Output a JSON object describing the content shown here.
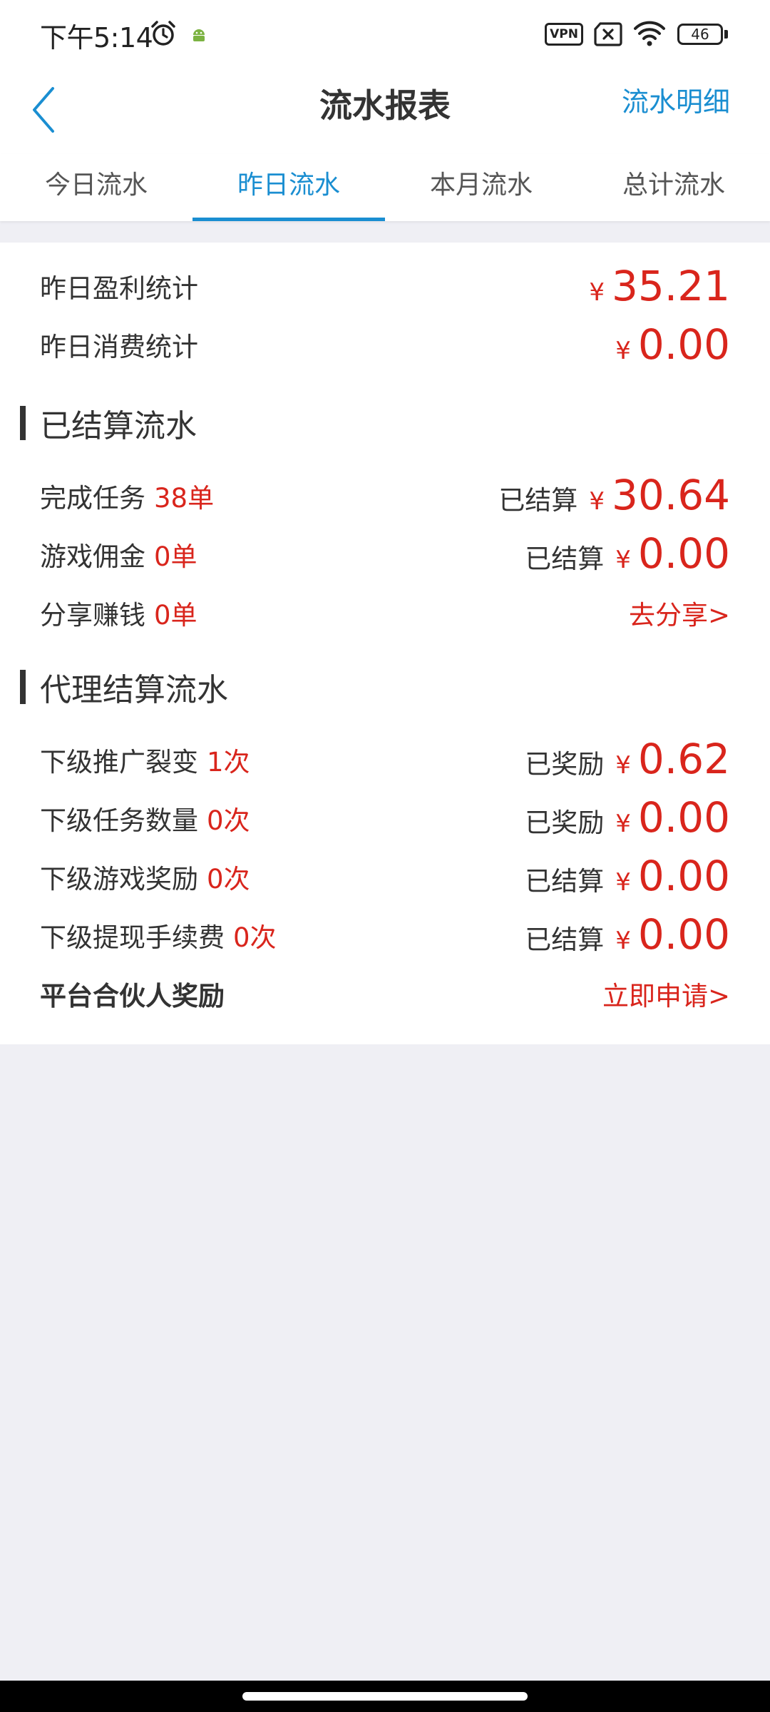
{
  "status_bar": {
    "time": "下午5:14",
    "vpn": "VPN",
    "battery": "46"
  },
  "nav": {
    "title": "流水报表",
    "right_link": "流水明细"
  },
  "tabs": [
    {
      "label": "今日流水",
      "active": false
    },
    {
      "label": "昨日流水",
      "active": true
    },
    {
      "label": "本月流水",
      "active": false
    },
    {
      "label": "总计流水",
      "active": false
    }
  ],
  "summary": {
    "profit_label": "昨日盈利统计",
    "profit_yen": "¥",
    "profit_amount": "35.21",
    "consume_label": "昨日消费统计",
    "consume_yen": "¥",
    "consume_amount": "0.00"
  },
  "settled_section": {
    "title": "已结算流水",
    "rows": [
      {
        "label": "完成任务",
        "count": "38单",
        "status": "已结算",
        "yen": "¥",
        "amount": "30.64"
      },
      {
        "label": "游戏佣金",
        "count": "0单",
        "status": "已结算",
        "yen": "¥",
        "amount": "0.00"
      },
      {
        "label": "分享赚钱",
        "count": "0单",
        "link": "去分享>"
      }
    ]
  },
  "agent_section": {
    "title": "代理结算流水",
    "rows": [
      {
        "label": "下级推广裂变",
        "count": "1次",
        "status": "已奖励",
        "yen": "¥",
        "amount": "0.62"
      },
      {
        "label": "下级任务数量",
        "count": "0次",
        "status": "已奖励",
        "yen": "¥",
        "amount": "0.00"
      },
      {
        "label": "下级游戏奖励",
        "count": "0次",
        "status": "已结算",
        "yen": "¥",
        "amount": "0.00"
      },
      {
        "label": "下级提现手续费",
        "count": "0次",
        "status": "已结算",
        "yen": "¥",
        "amount": "0.00"
      }
    ],
    "partner_label": "平台合伙人奖励",
    "partner_link": "立即申请>"
  },
  "colors": {
    "accent_blue": "#1a8ed1",
    "money_red": "#d9251c",
    "background": "#efeff4"
  }
}
